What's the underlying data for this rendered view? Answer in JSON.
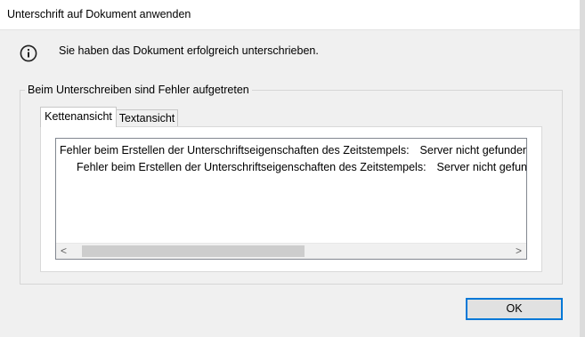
{
  "window": {
    "title": "Unterschrift auf Dokument anwenden"
  },
  "message": {
    "icon": "info-circle-icon",
    "text": "Sie haben das Dokument erfolgreich unterschrieben."
  },
  "group": {
    "legend": "Beim Unterschreiben sind Fehler aufgetreten"
  },
  "tabs": [
    {
      "label": "Kettenansicht",
      "active": true
    },
    {
      "label": "Textansicht",
      "active": false
    }
  ],
  "errors": [
    {
      "message": "Fehler beim Erstellen der Unterschriftseigenschaften des Zeitstempels:",
      "detail": "Server nicht gefunden. Fehl"
    },
    {
      "message": "Fehler beim Erstellen der Unterschriftseigenschaften des Zeitstempels:",
      "detail": "Server nicht gefunden. F"
    }
  ],
  "scrollbar": {
    "left_arrow": "<",
    "right_arrow": ">"
  },
  "buttons": {
    "ok": "OK"
  },
  "colors": {
    "accent": "#0078d7",
    "background": "#f0f0f0"
  }
}
